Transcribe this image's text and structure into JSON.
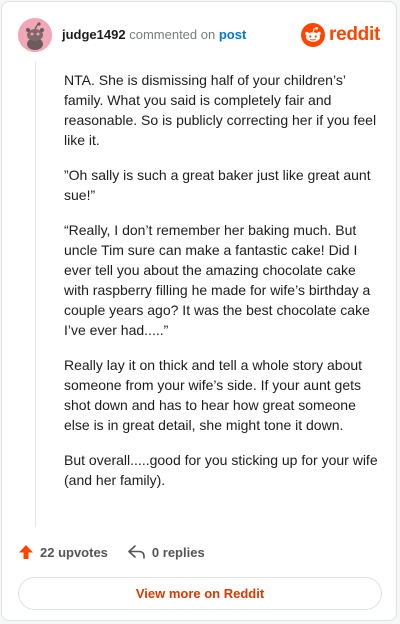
{
  "header": {
    "username": "judge1492",
    "action_text": "commented on",
    "post_link": "post",
    "logo_text": "reddit",
    "brand_color": "#ff4500"
  },
  "comment": {
    "paragraphs": [
      "NTA. She is dismissing half of your children’s’ family. What you said is completely fair and reasonable. So is publicly correcting her if you feel like it.",
      "”Oh sally is such a great baker just like great aunt sue!”",
      "“Really, I don’t remember her baking much. But uncle Tim sure can make a fantastic cake! Did I ever tell you about the amazing chocolate cake with raspberry filling he made for wife’s birthday a couple years ago? It was the best chocolate cake I’ve ever had.....”",
      "Really lay it on thick and tell a whole story about someone from your wife’s side. If your aunt gets shot down and has to hear how great someone else is in great detail, she might tone it down.",
      "But overall.....good for you sticking up for your wife (and her family)."
    ]
  },
  "footer": {
    "upvotes": "22 upvotes",
    "replies": "0 replies",
    "upvote_icon": "arrow-up-icon",
    "reply_icon": "reply-arrow-icon"
  },
  "cta": {
    "label": "View more on Reddit"
  }
}
